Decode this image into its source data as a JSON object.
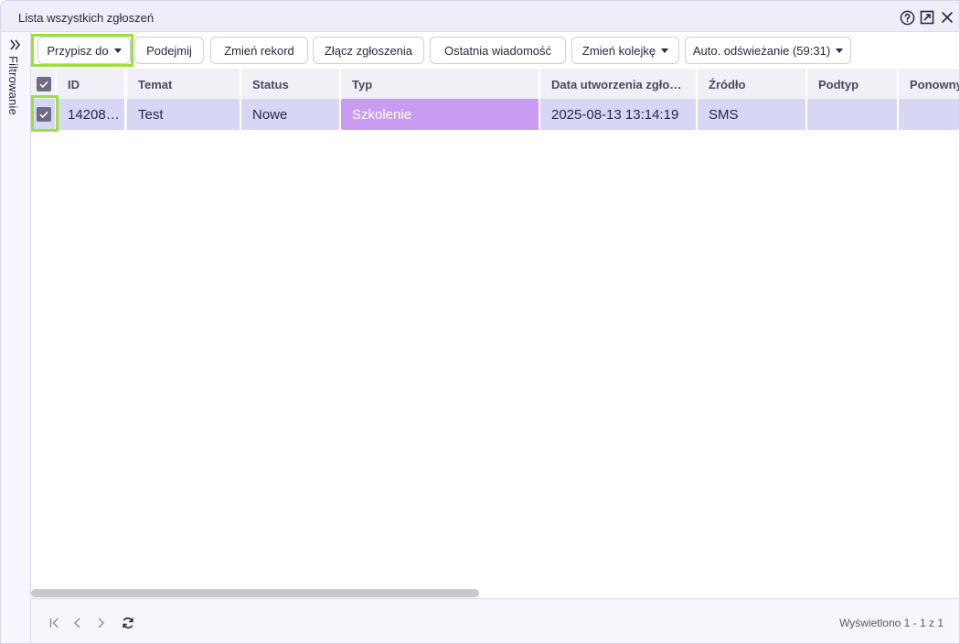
{
  "window": {
    "title": "Lista wszystkich zgłoszeń"
  },
  "title_icons": [
    "help-icon",
    "popout-icon",
    "close-icon"
  ],
  "sidebar": {
    "label": "Filtrowanie",
    "icon": "double-chevron-right-icon"
  },
  "toolbar": {
    "assign_label": "Przypisz do",
    "take_label": "Podejmij",
    "change_record_label": "Zmień rekord",
    "merge_label": "Złącz zgłoszenia",
    "last_message_label": "Ostatnia wiadomość",
    "change_queue_label": "Zmień kolejkę",
    "auto_refresh_label": "Auto. odświeżanie (59:31)"
  },
  "table": {
    "headers": {
      "id": "ID",
      "temat": "Temat",
      "status": "Status",
      "typ": "Typ",
      "data": "Data utworzenia zgło…",
      "zrodlo": "Źródło",
      "podtyp": "Podtyp",
      "ponowny": "Ponowny"
    },
    "rows": [
      {
        "checked": true,
        "id": "14208…",
        "temat": "Test",
        "status": "Nowe",
        "typ": "Szkolenie",
        "data": "2025-08-13 13:14:19",
        "zrodlo": "SMS",
        "podtyp": "",
        "ponowny": ""
      }
    ]
  },
  "footer": {
    "summary": "Wyświetlono 1 - 1 z 1"
  },
  "colors": {
    "highlight": "#9ee03a",
    "row_bg": "#d7d7f5",
    "type_badge": "#c99cf2",
    "checkbox": "#6f6b86"
  }
}
